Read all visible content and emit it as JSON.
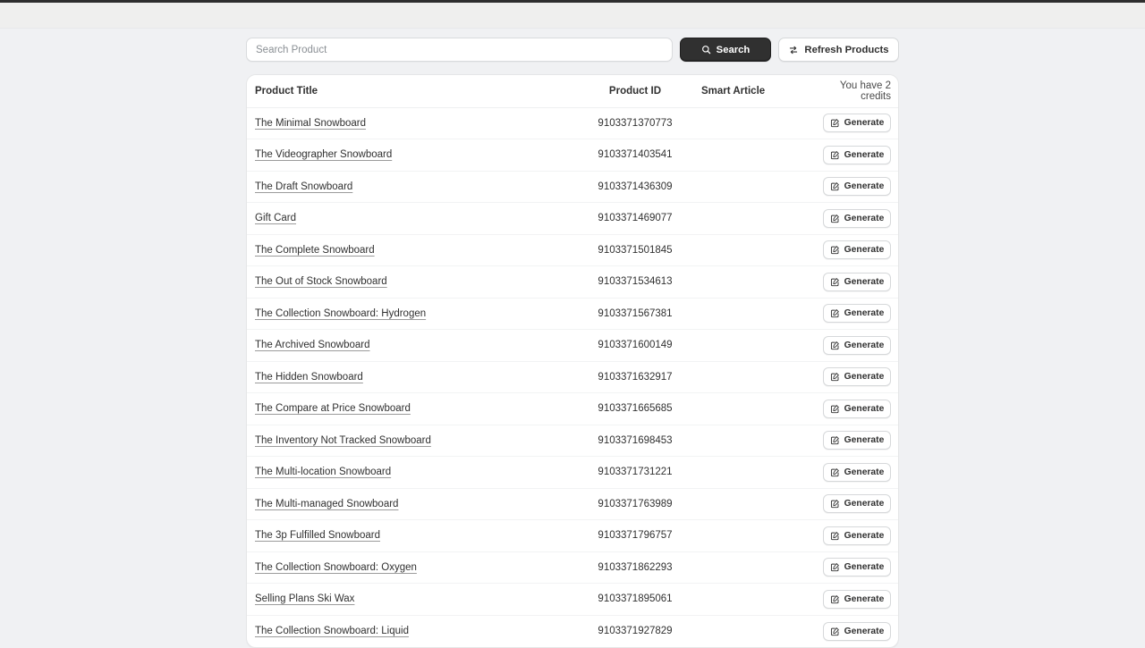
{
  "window": {
    "chrome_bar_color": "#2e2e2e",
    "chrome_strip_color": "#efefee",
    "page_background": "#f0f1f3"
  },
  "toolbar": {
    "search_placeholder": "Search Product",
    "search_value": "",
    "search_button_label": "Search",
    "search_icon": "search-icon",
    "refresh_button_label": "Refresh Products",
    "refresh_icon": "refresh-swap-icon",
    "primary_button_color": "#303030"
  },
  "table": {
    "headers": {
      "title": "Product Title",
      "product_id": "Product ID",
      "smart_article": "Smart Article",
      "credits": "You have 2 credits"
    },
    "action_label": "Generate",
    "action_icon": "compose-edit-icon",
    "rows": [
      {
        "title": "The Minimal Snowboard",
        "product_id": "9103371370773",
        "smart_article": "",
        "action": "Generate"
      },
      {
        "title": "The Videographer Snowboard",
        "product_id": "9103371403541",
        "smart_article": "",
        "action": "Generate"
      },
      {
        "title": "The Draft Snowboard",
        "product_id": "9103371436309",
        "smart_article": "",
        "action": "Generate"
      },
      {
        "title": "Gift Card",
        "product_id": "9103371469077",
        "smart_article": "",
        "action": "Generate"
      },
      {
        "title": "The Complete Snowboard",
        "product_id": "9103371501845",
        "smart_article": "",
        "action": "Generate"
      },
      {
        "title": "The Out of Stock Snowboard",
        "product_id": "9103371534613",
        "smart_article": "",
        "action": "Generate"
      },
      {
        "title": "The Collection Snowboard: Hydrogen",
        "product_id": "9103371567381",
        "smart_article": "",
        "action": "Generate"
      },
      {
        "title": "The Archived Snowboard",
        "product_id": "9103371600149",
        "smart_article": "",
        "action": "Generate"
      },
      {
        "title": "The Hidden Snowboard",
        "product_id": "9103371632917",
        "smart_article": "",
        "action": "Generate"
      },
      {
        "title": "The Compare at Price Snowboard",
        "product_id": "9103371665685",
        "smart_article": "",
        "action": "Generate"
      },
      {
        "title": "The Inventory Not Tracked Snowboard",
        "product_id": "9103371698453",
        "smart_article": "",
        "action": "Generate"
      },
      {
        "title": "The Multi-location Snowboard",
        "product_id": "9103371731221",
        "smart_article": "",
        "action": "Generate"
      },
      {
        "title": "The Multi-managed Snowboard",
        "product_id": "9103371763989",
        "smart_article": "",
        "action": "Generate"
      },
      {
        "title": "The 3p Fulfilled Snowboard",
        "product_id": "9103371796757",
        "smart_article": "",
        "action": "Generate"
      },
      {
        "title": "The Collection Snowboard: Oxygen",
        "product_id": "9103371862293",
        "smart_article": "",
        "action": "Generate"
      },
      {
        "title": "Selling Plans Ski Wax",
        "product_id": "9103371895061",
        "smart_article": "",
        "action": "Generate"
      },
      {
        "title": "The Collection Snowboard: Liquid",
        "product_id": "9103371927829",
        "smart_article": "",
        "action": "Generate"
      }
    ]
  }
}
